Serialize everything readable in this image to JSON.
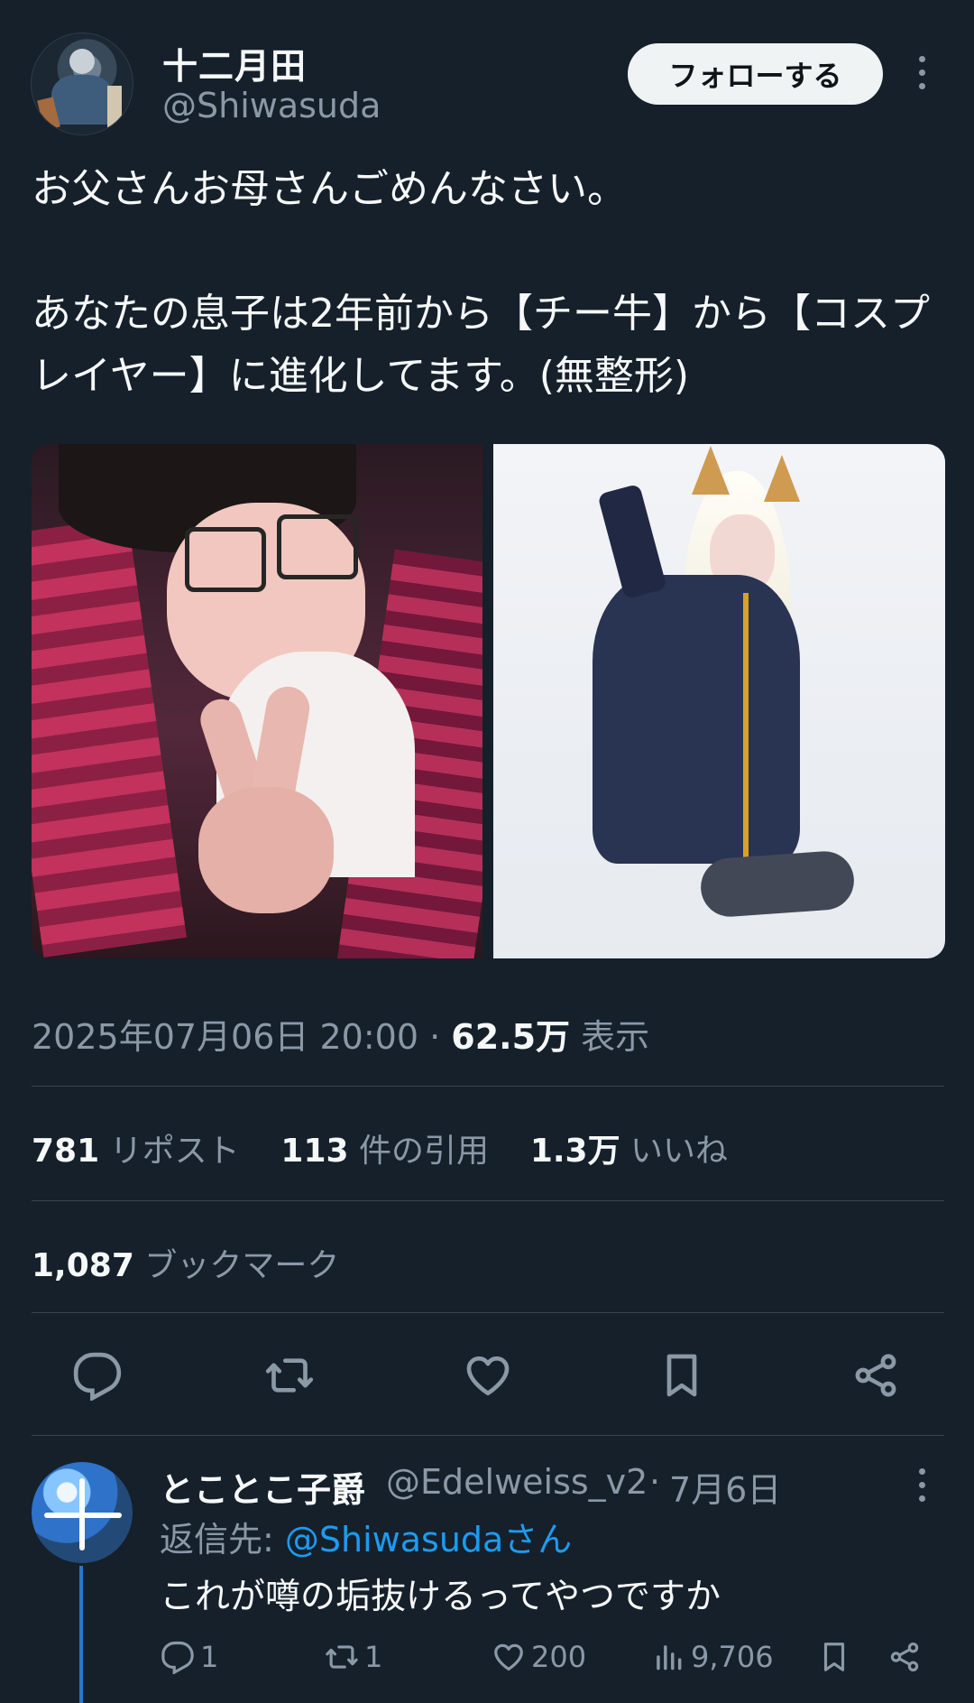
{
  "header": {
    "display_name": "十二月田",
    "handle": "@Shiwasuda",
    "follow_label": "フォローする"
  },
  "tweet": {
    "text": "お父さんお母さんごめんなさい。\n\nあなたの息子は2年前から【チー牛】から【コスプレイヤー】に進化してます。(無整形)"
  },
  "meta": {
    "timestamp": "2025年07月06日 20:00",
    "separator": "·",
    "views_count": "62.5万",
    "views_label": "表示"
  },
  "stats": {
    "reposts_count": "781",
    "reposts_label": "リポスト",
    "quotes_count": "113",
    "quotes_label": "件の引用",
    "likes_count": "1.3万",
    "likes_label": "いいね",
    "bookmarks_count": "1,087",
    "bookmarks_label": "ブックマーク"
  },
  "actions": [
    {
      "icon": "reply-icon"
    },
    {
      "icon": "repost-icon"
    },
    {
      "icon": "like-icon"
    },
    {
      "icon": "bookmark-icon"
    },
    {
      "icon": "share-icon"
    }
  ],
  "reply": {
    "display_name": "とことこ子爵",
    "handle": "@Edelweiss_v2",
    "separator": "·",
    "date": "7月6日",
    "reply_to_label": "返信先: ",
    "reply_to_handle": "@Shiwasudaさん",
    "text": "これが噂の垢抜けるってやつですか",
    "reply_count": "1",
    "repost_count": "1",
    "like_count": "200",
    "views_count": "9,706"
  },
  "colors": {
    "background": "#15202b",
    "text": "#f7f9f9",
    "muted": "#8b98a5",
    "accent": "#1d9bf0",
    "separator": "#38444d"
  }
}
